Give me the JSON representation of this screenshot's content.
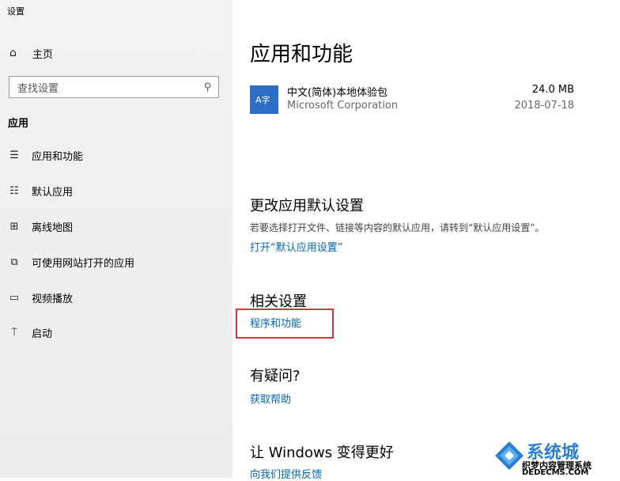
{
  "window": {
    "title": "设置"
  },
  "sidebar": {
    "home": {
      "label": "主页",
      "icon": "home-icon"
    },
    "search": {
      "placeholder": "查找设置",
      "icon": "search-icon"
    },
    "section_header": "应用",
    "items": [
      {
        "label": "应用和功能",
        "icon": "apps-list-icon"
      },
      {
        "label": "默认应用",
        "icon": "default-apps-icon"
      },
      {
        "label": "离线地图",
        "icon": "map-icon"
      },
      {
        "label": "可使用网站打开的应用",
        "icon": "open-web-icon"
      },
      {
        "label": "视频播放",
        "icon": "video-icon"
      },
      {
        "label": "启动",
        "icon": "startup-icon"
      }
    ]
  },
  "main": {
    "title": "应用和功能",
    "app": {
      "tile_text": "A字",
      "name": "中文(简体)本地体验包",
      "publisher": "Microsoft Corporation",
      "size": "24.0 MB",
      "date": "2018-07-18",
      "tile_color": "#2b6dc7"
    },
    "default_section": {
      "title": "更改应用默认设置",
      "desc": "若要选择打开文件、链接等内容的默认应用，请转到“默认应用设置”。",
      "link": "打开“默认应用设置”"
    },
    "related": {
      "title": "相关设置",
      "link": "程序和功能"
    },
    "question": {
      "title": "有疑问?",
      "link": "获取帮助"
    },
    "improve": {
      "title": "让 Windows 变得更好",
      "link": "向我们提供反馈"
    }
  },
  "watermark": {
    "big": "系统城",
    "small": "织梦内容管理系统",
    "url": "DEDECMS.COM",
    "brand_color": "#2a7fd4"
  },
  "colors": {
    "accent": "#0067b8",
    "highlight": "#e0303a"
  }
}
